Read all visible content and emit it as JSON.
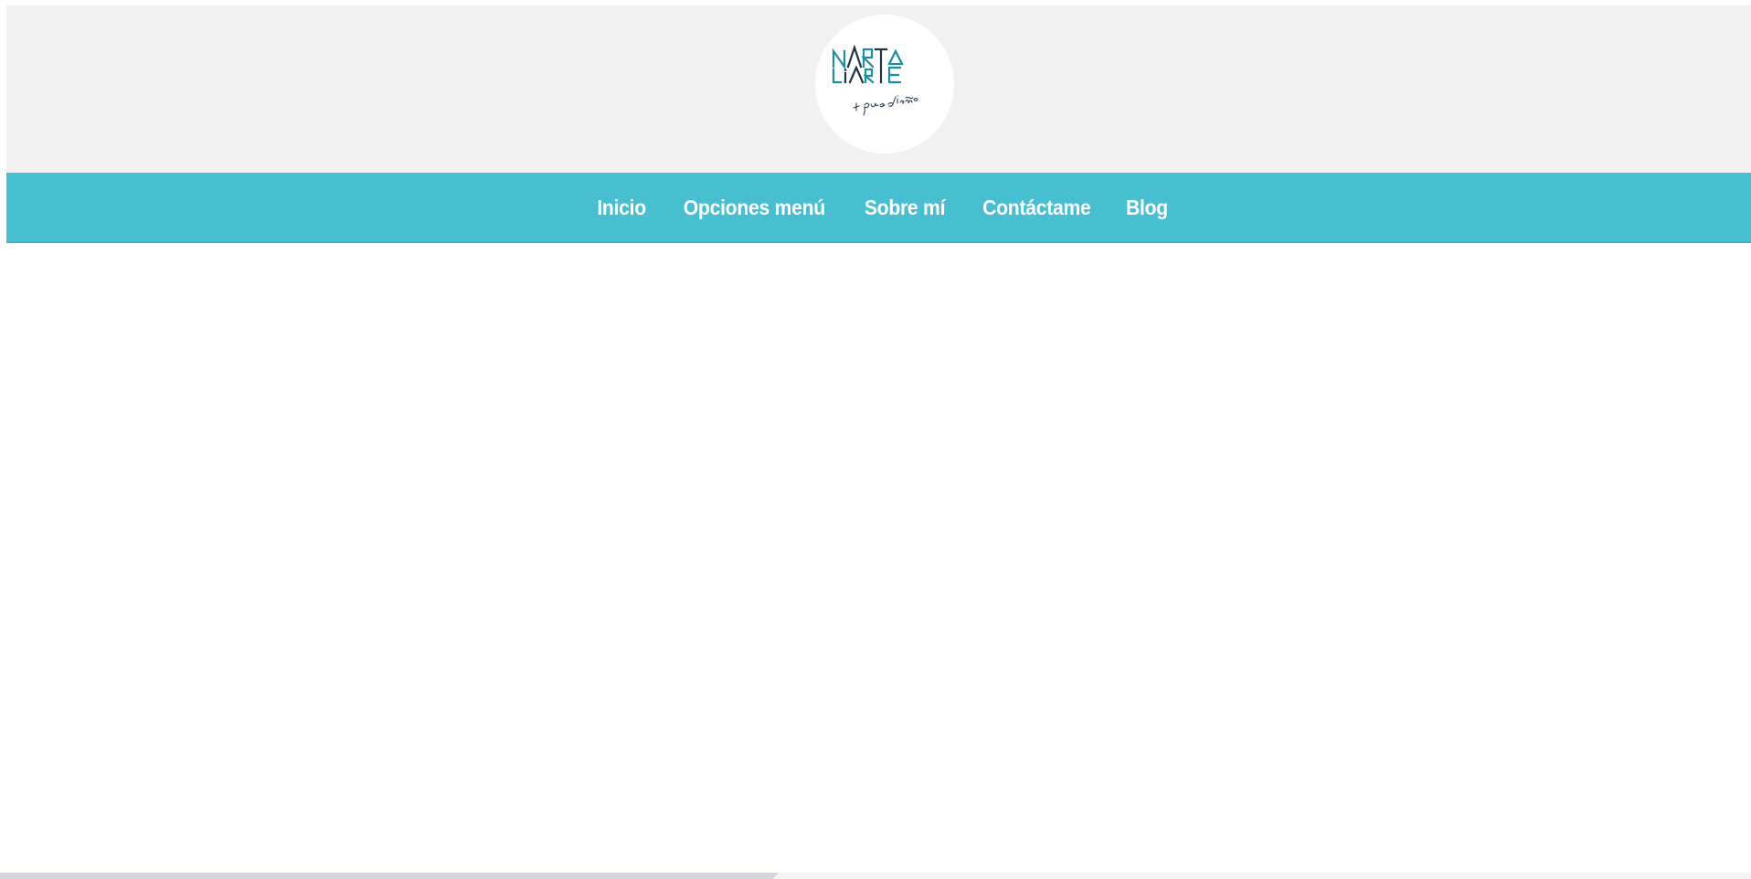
{
  "brand": {
    "logo_line1": "MARTA",
    "logo_line2": "LIARTE",
    "tagline": "+ que diseño",
    "colors": {
      "teal": "#1b8ea0",
      "dark": "#1f3441"
    }
  },
  "nav": {
    "items": [
      {
        "label": "Inicio"
      },
      {
        "label": "Opciones menú"
      },
      {
        "label": "Sobre mí"
      },
      {
        "label": "Contáctame"
      },
      {
        "label": "Blog"
      }
    ]
  },
  "theme": {
    "header_bg": "#f1f1f1",
    "nav_bg": "#48bfd1",
    "nav_text": "#ffffff",
    "page_bg": "#ffffff"
  }
}
